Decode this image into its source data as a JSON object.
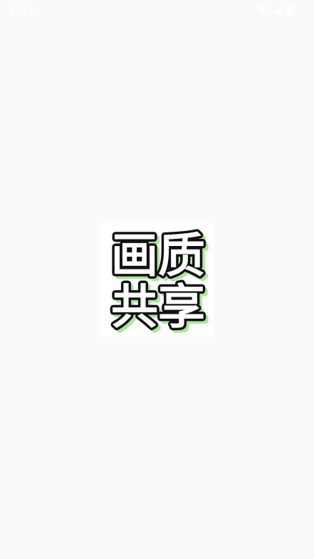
{
  "status_bar": {
    "time": "3:34",
    "icons": [
      "wifi-icon",
      "cellular-signal-icon",
      "battery-icon"
    ],
    "icon_color": "#ffffff"
  },
  "splash": {
    "logo_text": "画质共享",
    "logo_text_color": "#ffffff",
    "logo_stroke_color": "#111111",
    "logo_shadow_color": "#a9e79a",
    "background_color": "#fafafa"
  }
}
